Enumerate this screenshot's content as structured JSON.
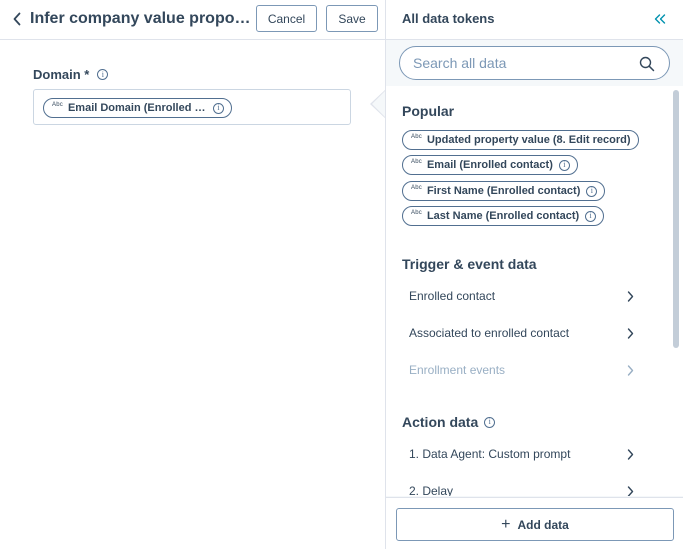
{
  "header": {
    "title": "Infer company value proposition",
    "cancel_label": "Cancel",
    "save_label": "Save"
  },
  "field": {
    "label": "Domain *",
    "token": {
      "type_badge": "Abc",
      "label": "Email Domain (Enrolled contact)"
    }
  },
  "panel": {
    "title": "All data tokens",
    "search_placeholder": "Search all data",
    "popular": {
      "heading": "Popular",
      "tokens": [
        {
          "type_badge": "Abc",
          "label": "Updated property value (8. Edit record)",
          "has_info": false
        },
        {
          "type_badge": "Abc",
          "label": "Email (Enrolled contact)",
          "has_info": true
        },
        {
          "type_badge": "Abc",
          "label": "First Name (Enrolled contact)",
          "has_info": true
        },
        {
          "type_badge": "Abc",
          "label": "Last Name (Enrolled contact)",
          "has_info": true
        }
      ]
    },
    "trigger": {
      "heading": "Trigger & event data",
      "items": [
        {
          "label": "Enrolled contact",
          "disabled": false
        },
        {
          "label": "Associated to enrolled contact",
          "disabled": false
        },
        {
          "label": "Enrollment events",
          "disabled": true
        }
      ]
    },
    "action": {
      "heading": "Action data",
      "items": [
        {
          "label": "1. Data Agent: Custom prompt",
          "disabled": false
        },
        {
          "label": "2. Delay",
          "disabled": false
        }
      ]
    },
    "add_data_label": "Add data"
  },
  "colors": {
    "text": "#33475b",
    "border": "#7c98b6",
    "panel_bg": "#f5f8fa",
    "disabled_text": "#99afc4"
  }
}
